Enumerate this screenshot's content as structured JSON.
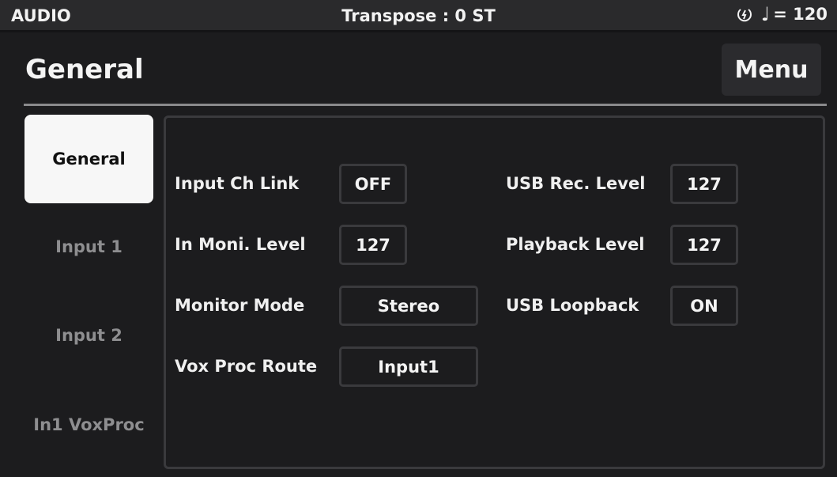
{
  "status_bar": {
    "mode": "AUDIO",
    "transpose": "Transpose : 0 ST",
    "tempo_note": "♩",
    "tempo": "= 120",
    "power_icon": "power-icon"
  },
  "header": {
    "title": "General",
    "menu_label": "Menu"
  },
  "sidebar": {
    "tabs": [
      {
        "label": "General",
        "active": true
      },
      {
        "label": "Input 1",
        "active": false
      },
      {
        "label": "Input 2",
        "active": false
      },
      {
        "label": "In1 VoxProc",
        "active": false
      }
    ]
  },
  "params": {
    "left": [
      {
        "label": "Input Ch Link",
        "value": "OFF"
      },
      {
        "label": "In Moni. Level",
        "value": "127"
      },
      {
        "label": "Monitor Mode",
        "value": "Stereo"
      },
      {
        "label": "Vox Proc Route",
        "value": "Input1"
      }
    ],
    "right": [
      {
        "label": "USB Rec. Level",
        "value": "127"
      },
      {
        "label": "Playback Level",
        "value": "127"
      },
      {
        "label": "USB Loopback",
        "value": "ON"
      }
    ]
  },
  "colors": {
    "background": "#1c1c1e",
    "active_tab": "#f7f7f7",
    "inactive_text": "#8e8e90",
    "border": "#3a3a3d"
  }
}
